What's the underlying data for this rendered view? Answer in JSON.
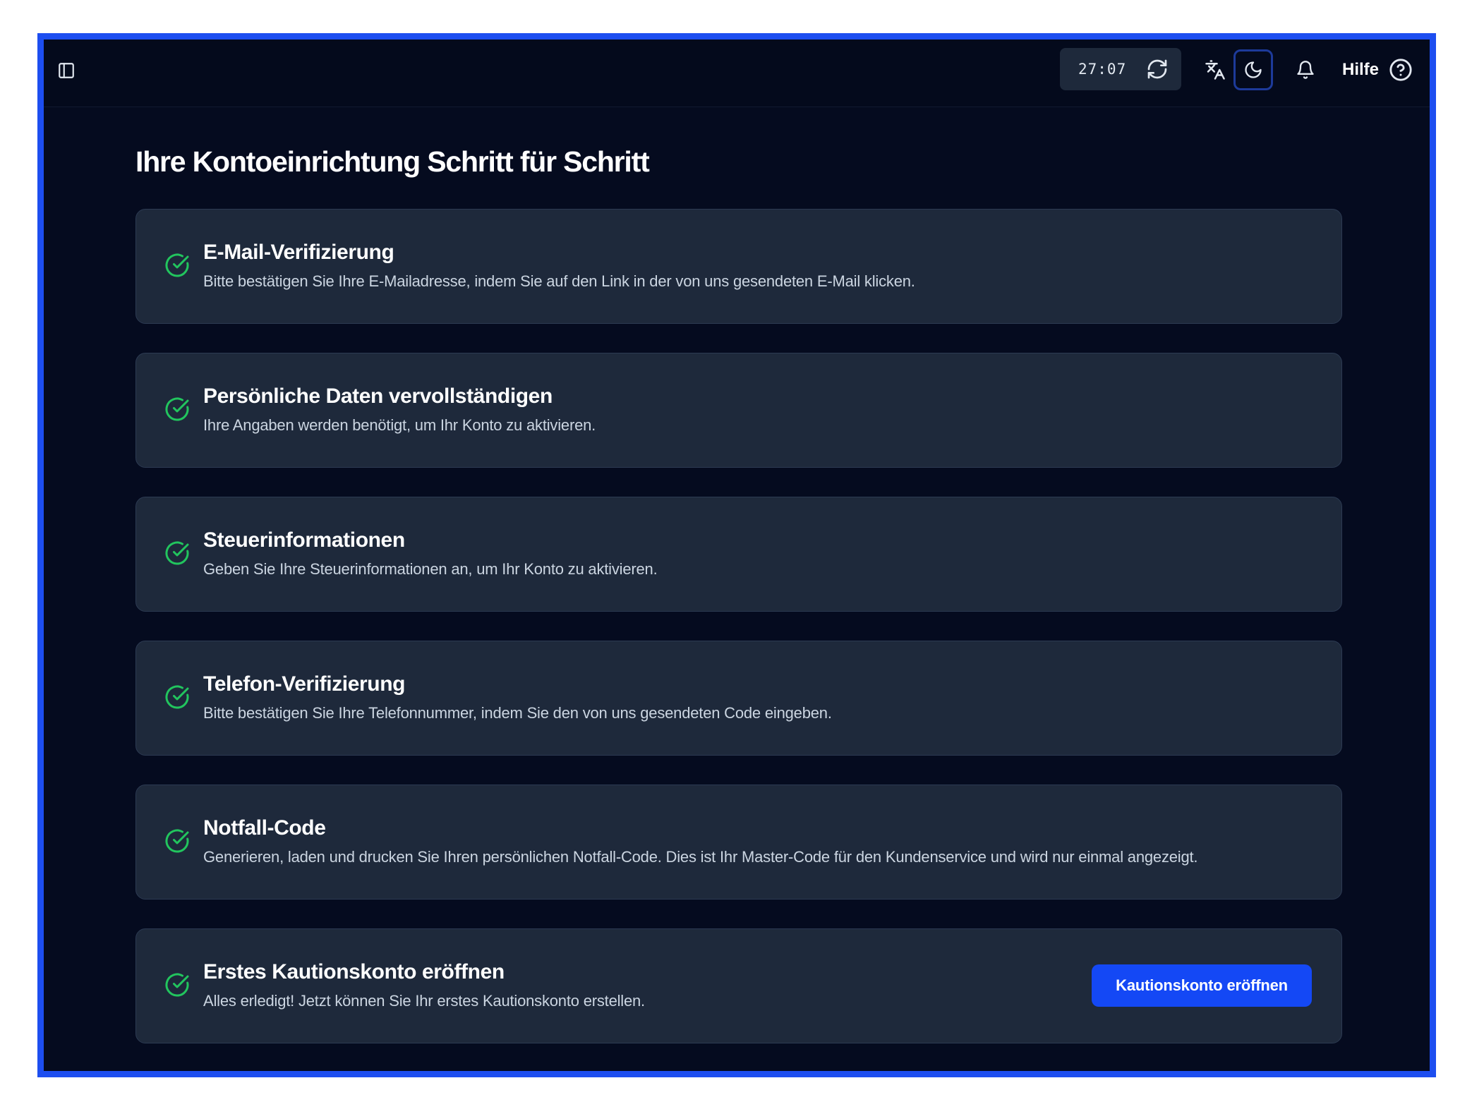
{
  "header": {
    "timer": "27:07",
    "help_label": "Hilfe",
    "icons": {
      "sidebar": "sidebar-toggle-icon",
      "refresh": "refresh-icon",
      "translate": "translate-icon",
      "theme": "moon-icon",
      "notifications": "bell-icon",
      "help": "help-circle-icon"
    }
  },
  "page": {
    "title": "Ihre Kontoeinrichtung Schritt für Schritt"
  },
  "steps": [
    {
      "title": "E-Mail-Verifizierung",
      "description": "Bitte bestätigen Sie Ihre E-Mailadresse, indem Sie auf den Link in der von uns gesendeten E-Mail klicken.",
      "status": "completed"
    },
    {
      "title": "Persönliche Daten vervollständigen",
      "description": "Ihre Angaben werden benötigt, um Ihr Konto zu aktivieren.",
      "status": "completed"
    },
    {
      "title": "Steuerinformationen",
      "description": "Geben Sie Ihre Steuerinformationen an, um Ihr Konto zu aktivieren.",
      "status": "completed"
    },
    {
      "title": "Telefon-Verifizierung",
      "description": "Bitte bestätigen Sie Ihre Telefonnummer, indem Sie den von uns gesendeten Code eingeben.",
      "status": "completed"
    },
    {
      "title": "Notfall-Code",
      "description": "Generieren, laden und drucken Sie Ihren persönlichen Notfall-Code. Dies ist Ihr Master-Code für den Kundenservice und wird nur einmal angezeigt.",
      "status": "completed"
    },
    {
      "title": "Erstes Kautionskonto eröffnen",
      "description": "Alles erledigt! Jetzt können Sie Ihr erstes Kautionskonto erstellen.",
      "status": "completed",
      "action_label": "Kautionskonto eröffnen"
    }
  ],
  "colors": {
    "frame_border": "#1d4ef0",
    "background": "#050b1f",
    "card": "#1e293b",
    "success": "#22c55e",
    "primary": "#1448f5"
  }
}
